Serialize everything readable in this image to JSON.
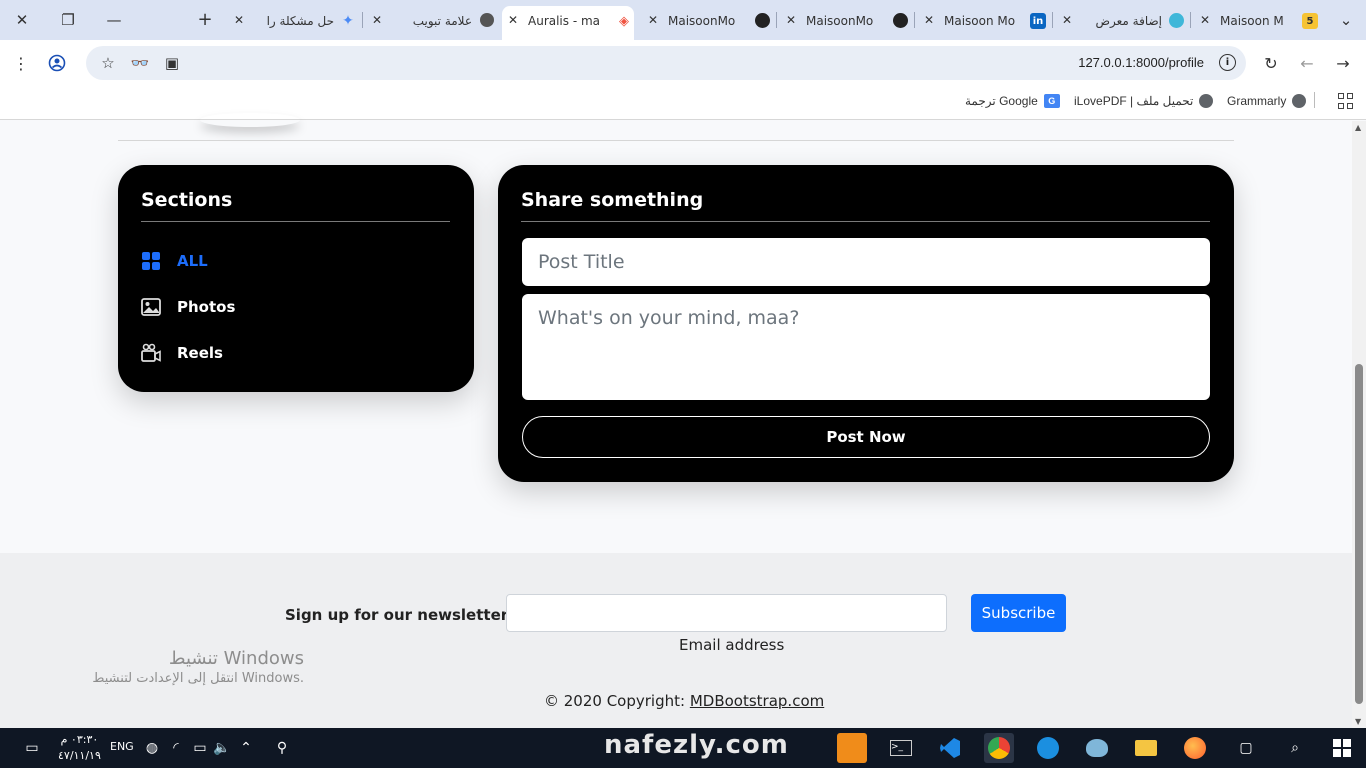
{
  "browser": {
    "tabs": [
      {
        "title": "Maisoon M",
        "favicon": "5"
      },
      {
        "title": "إضافة معرض",
        "favicon": ""
      },
      {
        "title": "Maisoon Mo",
        "favicon": "in"
      },
      {
        "title": "MaisoonMo",
        "favicon": ""
      },
      {
        "title": "MaisoonMo",
        "favicon": ""
      },
      {
        "title": "Auralis - ma",
        "favicon": ""
      },
      {
        "title": "علامة تبويب",
        "favicon": ""
      },
      {
        "title": "حل مشكلة را",
        "favicon": ""
      }
    ],
    "url": "127.0.0.1:8000/profile",
    "bookmarks": [
      {
        "label": "Grammarly"
      },
      {
        "label": "iLovePDF | تحميل ملف"
      },
      {
        "label": "ترجمة Google"
      }
    ]
  },
  "sections": {
    "heading": "Sections",
    "items": [
      {
        "label": "ALL",
        "icon": "grid-icon",
        "active": true
      },
      {
        "label": "Photos",
        "icon": "image-icon",
        "active": false
      },
      {
        "label": "Reels",
        "icon": "video-icon",
        "active": false
      }
    ]
  },
  "share": {
    "heading": "Share something",
    "title_placeholder": "Post Title",
    "body_placeholder": "What's on your mind, maa?",
    "post_button": "Post Now"
  },
  "footer": {
    "newsletter_label": "Sign up for our newsletter",
    "email_help": "Email address",
    "subscribe_button": "Subscribe",
    "copyright_prefix": "© 2020 Copyright: ",
    "copyright_link": "MDBootstrap.com"
  },
  "watermark": {
    "line1": "تنشيط Windows",
    "line2": "انتقل إلى الإعدادت لتنشيط Windows."
  },
  "overlay_watermark": "nafezly.com",
  "taskbar": {
    "time": "٠٣:٣٠ م",
    "date": "٤٧/١١/١٩",
    "language": "ENG"
  },
  "colors": {
    "accent": "#1d6dfa",
    "subscribe": "#0d6efd",
    "card": "#000000"
  }
}
